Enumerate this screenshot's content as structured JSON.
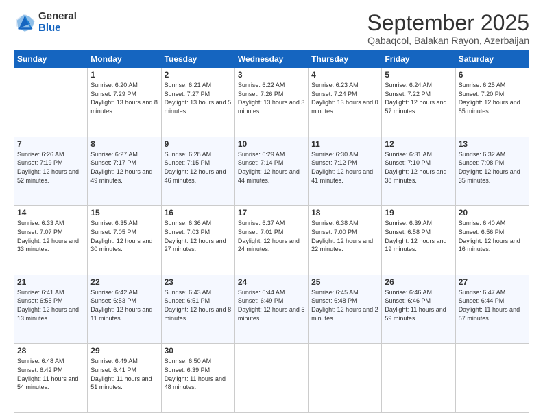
{
  "logo": {
    "general": "General",
    "blue": "Blue"
  },
  "header": {
    "title": "September 2025",
    "subtitle": "Qabaqcol, Balakan Rayon, Azerbaijan"
  },
  "weekdays": [
    "Sunday",
    "Monday",
    "Tuesday",
    "Wednesday",
    "Thursday",
    "Friday",
    "Saturday"
  ],
  "weeks": [
    [
      {
        "day": "",
        "sunrise": "",
        "sunset": "",
        "daylight": ""
      },
      {
        "day": "1",
        "sunrise": "Sunrise: 6:20 AM",
        "sunset": "Sunset: 7:29 PM",
        "daylight": "Daylight: 13 hours and 8 minutes."
      },
      {
        "day": "2",
        "sunrise": "Sunrise: 6:21 AM",
        "sunset": "Sunset: 7:27 PM",
        "daylight": "Daylight: 13 hours and 5 minutes."
      },
      {
        "day": "3",
        "sunrise": "Sunrise: 6:22 AM",
        "sunset": "Sunset: 7:26 PM",
        "daylight": "Daylight: 13 hours and 3 minutes."
      },
      {
        "day": "4",
        "sunrise": "Sunrise: 6:23 AM",
        "sunset": "Sunset: 7:24 PM",
        "daylight": "Daylight: 13 hours and 0 minutes."
      },
      {
        "day": "5",
        "sunrise": "Sunrise: 6:24 AM",
        "sunset": "Sunset: 7:22 PM",
        "daylight": "Daylight: 12 hours and 57 minutes."
      },
      {
        "day": "6",
        "sunrise": "Sunrise: 6:25 AM",
        "sunset": "Sunset: 7:20 PM",
        "daylight": "Daylight: 12 hours and 55 minutes."
      }
    ],
    [
      {
        "day": "7",
        "sunrise": "Sunrise: 6:26 AM",
        "sunset": "Sunset: 7:19 PM",
        "daylight": "Daylight: 12 hours and 52 minutes."
      },
      {
        "day": "8",
        "sunrise": "Sunrise: 6:27 AM",
        "sunset": "Sunset: 7:17 PM",
        "daylight": "Daylight: 12 hours and 49 minutes."
      },
      {
        "day": "9",
        "sunrise": "Sunrise: 6:28 AM",
        "sunset": "Sunset: 7:15 PM",
        "daylight": "Daylight: 12 hours and 46 minutes."
      },
      {
        "day": "10",
        "sunrise": "Sunrise: 6:29 AM",
        "sunset": "Sunset: 7:14 PM",
        "daylight": "Daylight: 12 hours and 44 minutes."
      },
      {
        "day": "11",
        "sunrise": "Sunrise: 6:30 AM",
        "sunset": "Sunset: 7:12 PM",
        "daylight": "Daylight: 12 hours and 41 minutes."
      },
      {
        "day": "12",
        "sunrise": "Sunrise: 6:31 AM",
        "sunset": "Sunset: 7:10 PM",
        "daylight": "Daylight: 12 hours and 38 minutes."
      },
      {
        "day": "13",
        "sunrise": "Sunrise: 6:32 AM",
        "sunset": "Sunset: 7:08 PM",
        "daylight": "Daylight: 12 hours and 35 minutes."
      }
    ],
    [
      {
        "day": "14",
        "sunrise": "Sunrise: 6:33 AM",
        "sunset": "Sunset: 7:07 PM",
        "daylight": "Daylight: 12 hours and 33 minutes."
      },
      {
        "day": "15",
        "sunrise": "Sunrise: 6:35 AM",
        "sunset": "Sunset: 7:05 PM",
        "daylight": "Daylight: 12 hours and 30 minutes."
      },
      {
        "day": "16",
        "sunrise": "Sunrise: 6:36 AM",
        "sunset": "Sunset: 7:03 PM",
        "daylight": "Daylight: 12 hours and 27 minutes."
      },
      {
        "day": "17",
        "sunrise": "Sunrise: 6:37 AM",
        "sunset": "Sunset: 7:01 PM",
        "daylight": "Daylight: 12 hours and 24 minutes."
      },
      {
        "day": "18",
        "sunrise": "Sunrise: 6:38 AM",
        "sunset": "Sunset: 7:00 PM",
        "daylight": "Daylight: 12 hours and 22 minutes."
      },
      {
        "day": "19",
        "sunrise": "Sunrise: 6:39 AM",
        "sunset": "Sunset: 6:58 PM",
        "daylight": "Daylight: 12 hours and 19 minutes."
      },
      {
        "day": "20",
        "sunrise": "Sunrise: 6:40 AM",
        "sunset": "Sunset: 6:56 PM",
        "daylight": "Daylight: 12 hours and 16 minutes."
      }
    ],
    [
      {
        "day": "21",
        "sunrise": "Sunrise: 6:41 AM",
        "sunset": "Sunset: 6:55 PM",
        "daylight": "Daylight: 12 hours and 13 minutes."
      },
      {
        "day": "22",
        "sunrise": "Sunrise: 6:42 AM",
        "sunset": "Sunset: 6:53 PM",
        "daylight": "Daylight: 12 hours and 11 minutes."
      },
      {
        "day": "23",
        "sunrise": "Sunrise: 6:43 AM",
        "sunset": "Sunset: 6:51 PM",
        "daylight": "Daylight: 12 hours and 8 minutes."
      },
      {
        "day": "24",
        "sunrise": "Sunrise: 6:44 AM",
        "sunset": "Sunset: 6:49 PM",
        "daylight": "Daylight: 12 hours and 5 minutes."
      },
      {
        "day": "25",
        "sunrise": "Sunrise: 6:45 AM",
        "sunset": "Sunset: 6:48 PM",
        "daylight": "Daylight: 12 hours and 2 minutes."
      },
      {
        "day": "26",
        "sunrise": "Sunrise: 6:46 AM",
        "sunset": "Sunset: 6:46 PM",
        "daylight": "Daylight: 11 hours and 59 minutes."
      },
      {
        "day": "27",
        "sunrise": "Sunrise: 6:47 AM",
        "sunset": "Sunset: 6:44 PM",
        "daylight": "Daylight: 11 hours and 57 minutes."
      }
    ],
    [
      {
        "day": "28",
        "sunrise": "Sunrise: 6:48 AM",
        "sunset": "Sunset: 6:42 PM",
        "daylight": "Daylight: 11 hours and 54 minutes."
      },
      {
        "day": "29",
        "sunrise": "Sunrise: 6:49 AM",
        "sunset": "Sunset: 6:41 PM",
        "daylight": "Daylight: 11 hours and 51 minutes."
      },
      {
        "day": "30",
        "sunrise": "Sunrise: 6:50 AM",
        "sunset": "Sunset: 6:39 PM",
        "daylight": "Daylight: 11 hours and 48 minutes."
      },
      {
        "day": "",
        "sunrise": "",
        "sunset": "",
        "daylight": ""
      },
      {
        "day": "",
        "sunrise": "",
        "sunset": "",
        "daylight": ""
      },
      {
        "day": "",
        "sunrise": "",
        "sunset": "",
        "daylight": ""
      },
      {
        "day": "",
        "sunrise": "",
        "sunset": "",
        "daylight": ""
      }
    ]
  ]
}
